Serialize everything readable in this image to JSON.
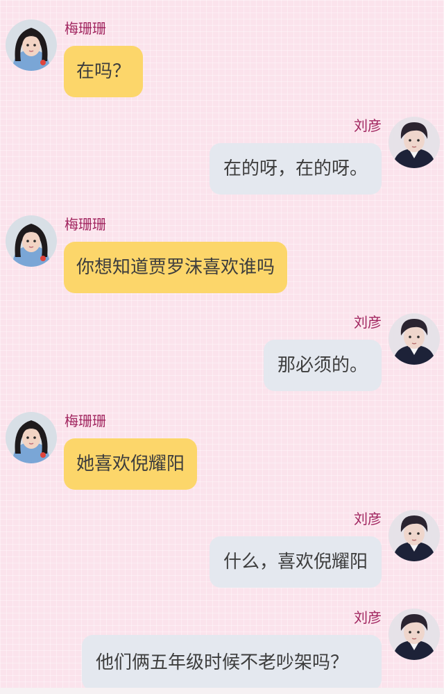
{
  "messages": [
    {
      "side": "left",
      "sender": "梅珊珊",
      "text": "在吗？"
    },
    {
      "side": "right",
      "sender": "刘彦",
      "text": "在的呀，在的呀。"
    },
    {
      "side": "left",
      "sender": "梅珊珊",
      "text": "你想知道贾罗沫喜欢谁吗"
    },
    {
      "side": "right",
      "sender": "刘彦",
      "text": "那必须的。"
    },
    {
      "side": "left",
      "sender": "梅珊珊",
      "text": "她喜欢倪耀阳"
    },
    {
      "side": "right",
      "sender": "刘彦",
      "text": "什么，喜欢倪耀阳"
    },
    {
      "side": "right",
      "sender": "刘彦",
      "text": "他们俩五年级时候不老吵架吗？"
    }
  ],
  "colors": {
    "background": "#fbe3ec",
    "left_bubble": "#fcd66a",
    "right_bubble": "#e4e8ef",
    "sender_name": "#a1255f",
    "message_text": "#3d3d3d"
  },
  "icons": {
    "left_avatar": "girl-avatar-icon",
    "right_avatar": "boy-avatar-icon"
  }
}
